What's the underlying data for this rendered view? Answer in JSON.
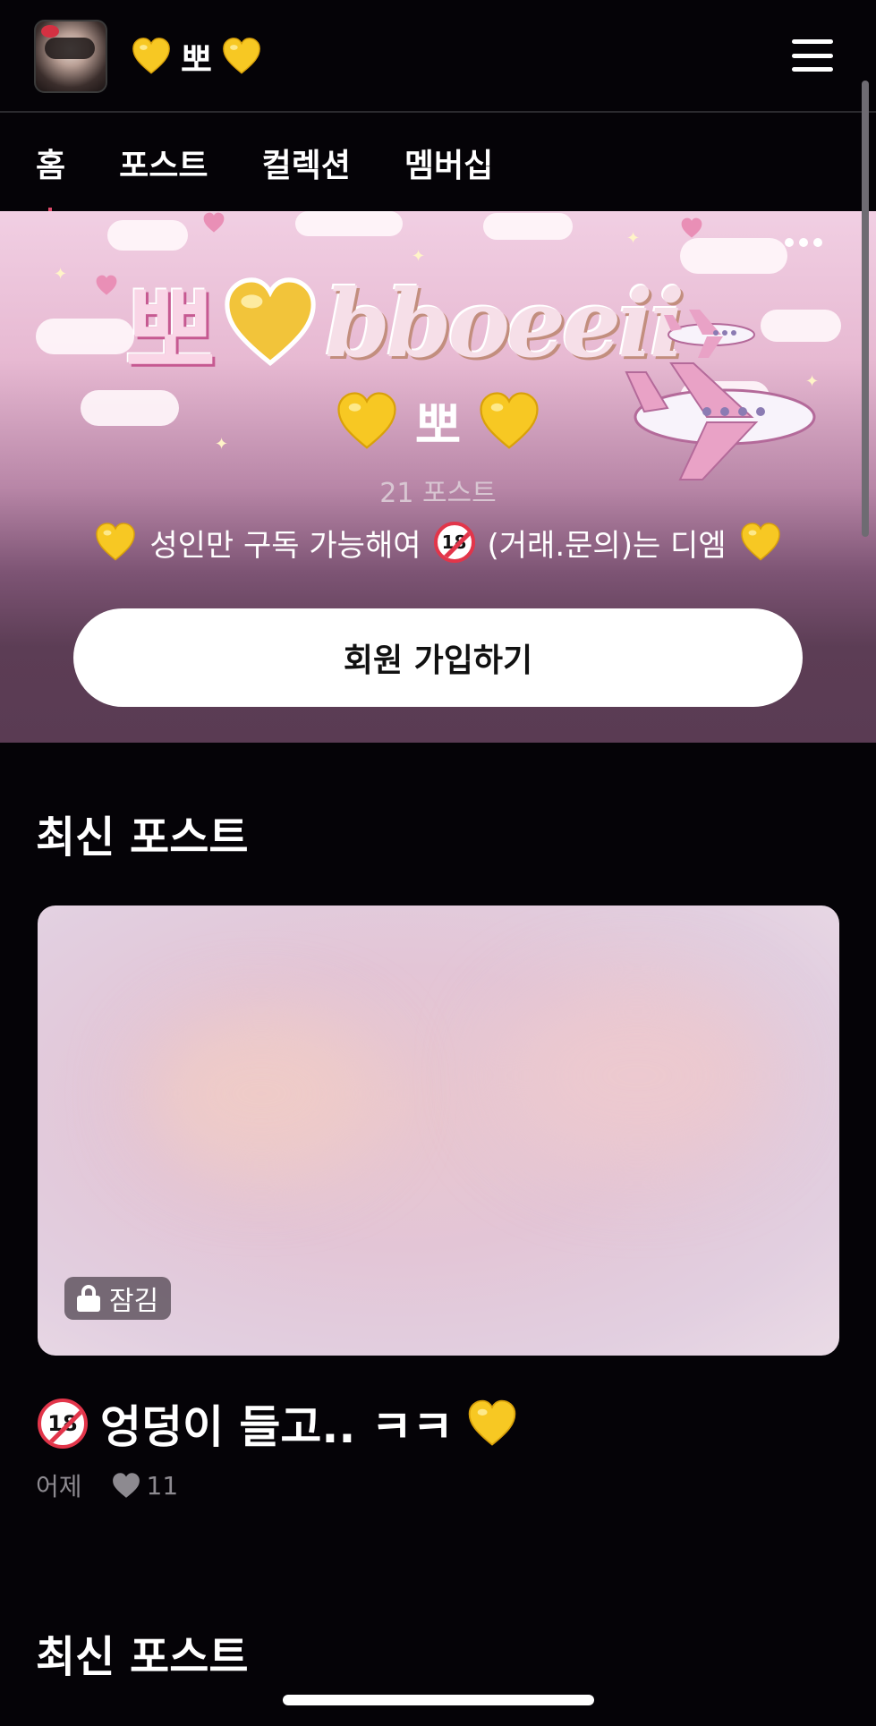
{
  "header": {
    "creator_name": "뽀",
    "heart_color": "#f7c823"
  },
  "tabs": [
    {
      "label": "홈"
    },
    {
      "label": "포스트"
    },
    {
      "label": "컬렉션"
    },
    {
      "label": "멤버십"
    }
  ],
  "hero": {
    "banner_korean": "뽀",
    "banner_script": "bboeeii",
    "name": "뽀",
    "post_count": "21 포스트",
    "bio_text": "성인만 구독 가능해여",
    "bio_text_2": "(거래.문의)는 디엠",
    "adult_badge": "18",
    "join_button": "회원 가입하기"
  },
  "latest_posts_title": "최신 포스트",
  "post": {
    "locked_label": "잠김",
    "title": "엉덩이 들고.. ㅋㅋ",
    "adult_badge": "18",
    "date": "어제",
    "likes": "11"
  },
  "latest_posts_title_2": "최신 포스트",
  "colors": {
    "background": "#050307",
    "accent_pink": "#e04a6a",
    "heart_yellow": "#f7c823"
  }
}
